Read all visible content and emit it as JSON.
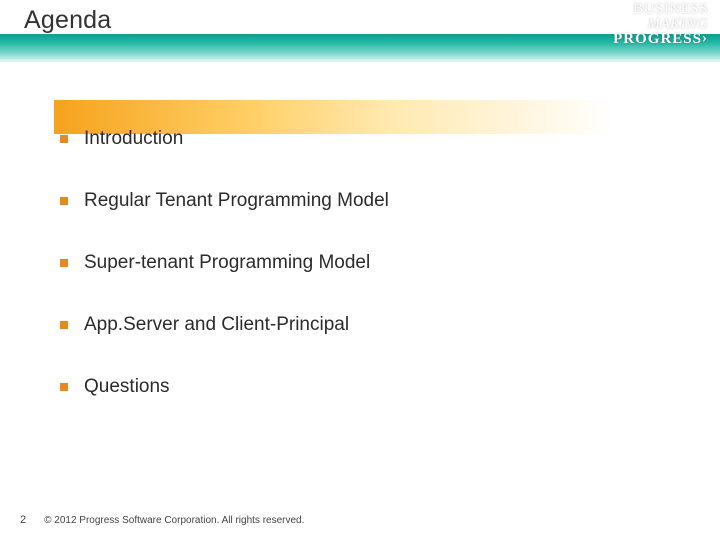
{
  "header": {
    "title": "Agenda",
    "logo_line1": "BUSINESS",
    "logo_line2": "MAKING",
    "logo_line3": "PROGRESS"
  },
  "agenda": {
    "items": [
      {
        "label": "Introduction",
        "highlighted": true
      },
      {
        "label": "Regular Tenant Programming Model",
        "highlighted": false
      },
      {
        "label": "Super-tenant Programming Model",
        "highlighted": false
      },
      {
        "label": "App.Server and Client-Principal",
        "highlighted": false
      },
      {
        "label": "Questions",
        "highlighted": false
      }
    ]
  },
  "footer": {
    "page_number": "2",
    "copyright": "© 2012 Progress Software Corporation. All rights reserved."
  },
  "colors": {
    "bullet": "#e58a1f",
    "teal_top": "#0f9e8f",
    "highlight": "#f6a21c"
  }
}
